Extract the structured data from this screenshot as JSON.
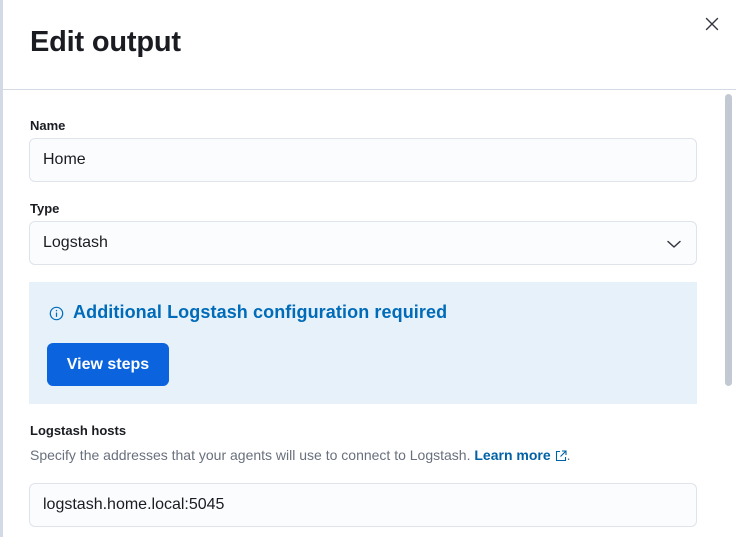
{
  "flyout": {
    "title": "Edit output",
    "close_icon": "close-icon"
  },
  "form": {
    "name": {
      "label": "Name",
      "value": "Home"
    },
    "type": {
      "label": "Type",
      "value": "Logstash",
      "icon": "chevron-down-icon"
    },
    "callout": {
      "icon": "info-icon",
      "title": "Additional Logstash configuration required",
      "button_label": "View steps",
      "color": "#006bb8",
      "background": "#e6f1fa"
    },
    "hosts": {
      "label": "Logstash hosts",
      "help_text": "Specify the addresses that your agents will use to connect to Logstash.",
      "help_link": "Learn more",
      "help_suffix": ".",
      "link_icon": "external-link-icon",
      "value": "logstash.home.local:5045"
    }
  },
  "colors": {
    "primary_button": "#0b64dd",
    "link": "#0061a6"
  }
}
